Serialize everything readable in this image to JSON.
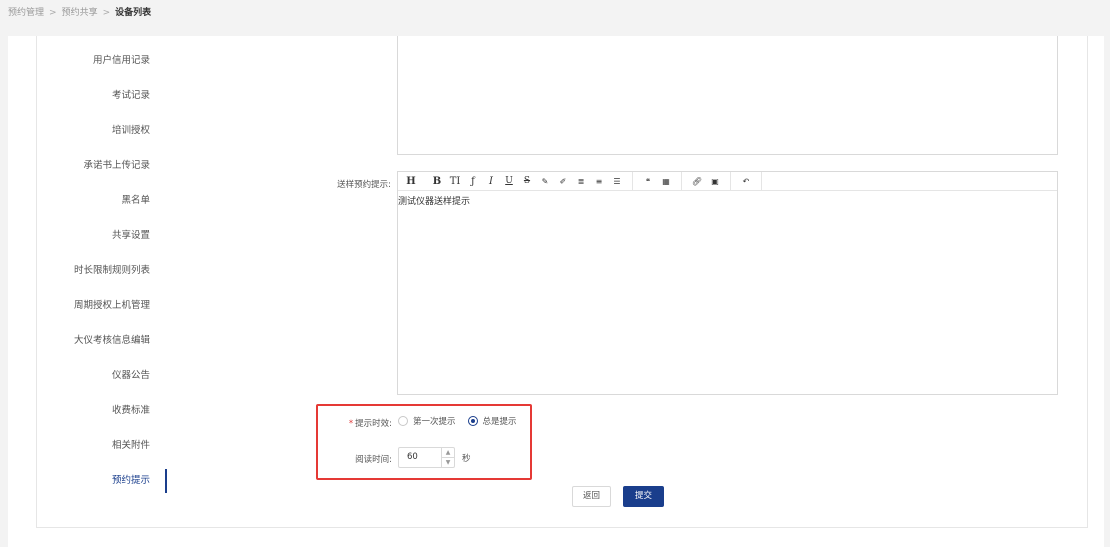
{
  "breadcrumb": {
    "items": [
      "预约管理",
      "预约共享"
    ],
    "current": "设备列表",
    "separator": ">"
  },
  "sidebar": {
    "items": [
      {
        "label": "用户信用记录"
      },
      {
        "label": "考试记录"
      },
      {
        "label": "培训授权"
      },
      {
        "label": "承诺书上传记录"
      },
      {
        "label": "黑名单"
      },
      {
        "label": "共享设置"
      },
      {
        "label": "时长限制规则列表"
      },
      {
        "label": "周期授权上机管理"
      },
      {
        "label": "大仪考核信息编辑"
      },
      {
        "label": "仪器公告"
      },
      {
        "label": "收费标准"
      },
      {
        "label": "相关附件"
      },
      {
        "label": "预约提示"
      }
    ],
    "active_index": 12
  },
  "form": {
    "tip_label": "送样预约提示:",
    "editor_content": "测试仪器送样提示",
    "effect_label": "提示时效:",
    "required_mark": "*",
    "radio_options": [
      "第一次提示",
      "总是提示"
    ],
    "radio_selected": 1,
    "read_time_label": "阅读时间:",
    "read_time_value": "60",
    "read_time_unit": "秒"
  },
  "toolbar": {
    "groups": [
      [
        "H",
        "B",
        "TI",
        "ƒ",
        "I",
        "U",
        "S",
        "✎",
        "✐",
        "≣",
        "≡",
        "☰"
      ],
      [
        "❝",
        "▦"
      ],
      [
        "🔗︎",
        "▣"
      ],
      [
        "↶"
      ]
    ]
  },
  "actions": {
    "back_label": "返回",
    "submit_label": "提交"
  },
  "colors": {
    "accent": "#1a3e8c",
    "required": "#e03b3b",
    "highlight_border": "#e53935"
  }
}
